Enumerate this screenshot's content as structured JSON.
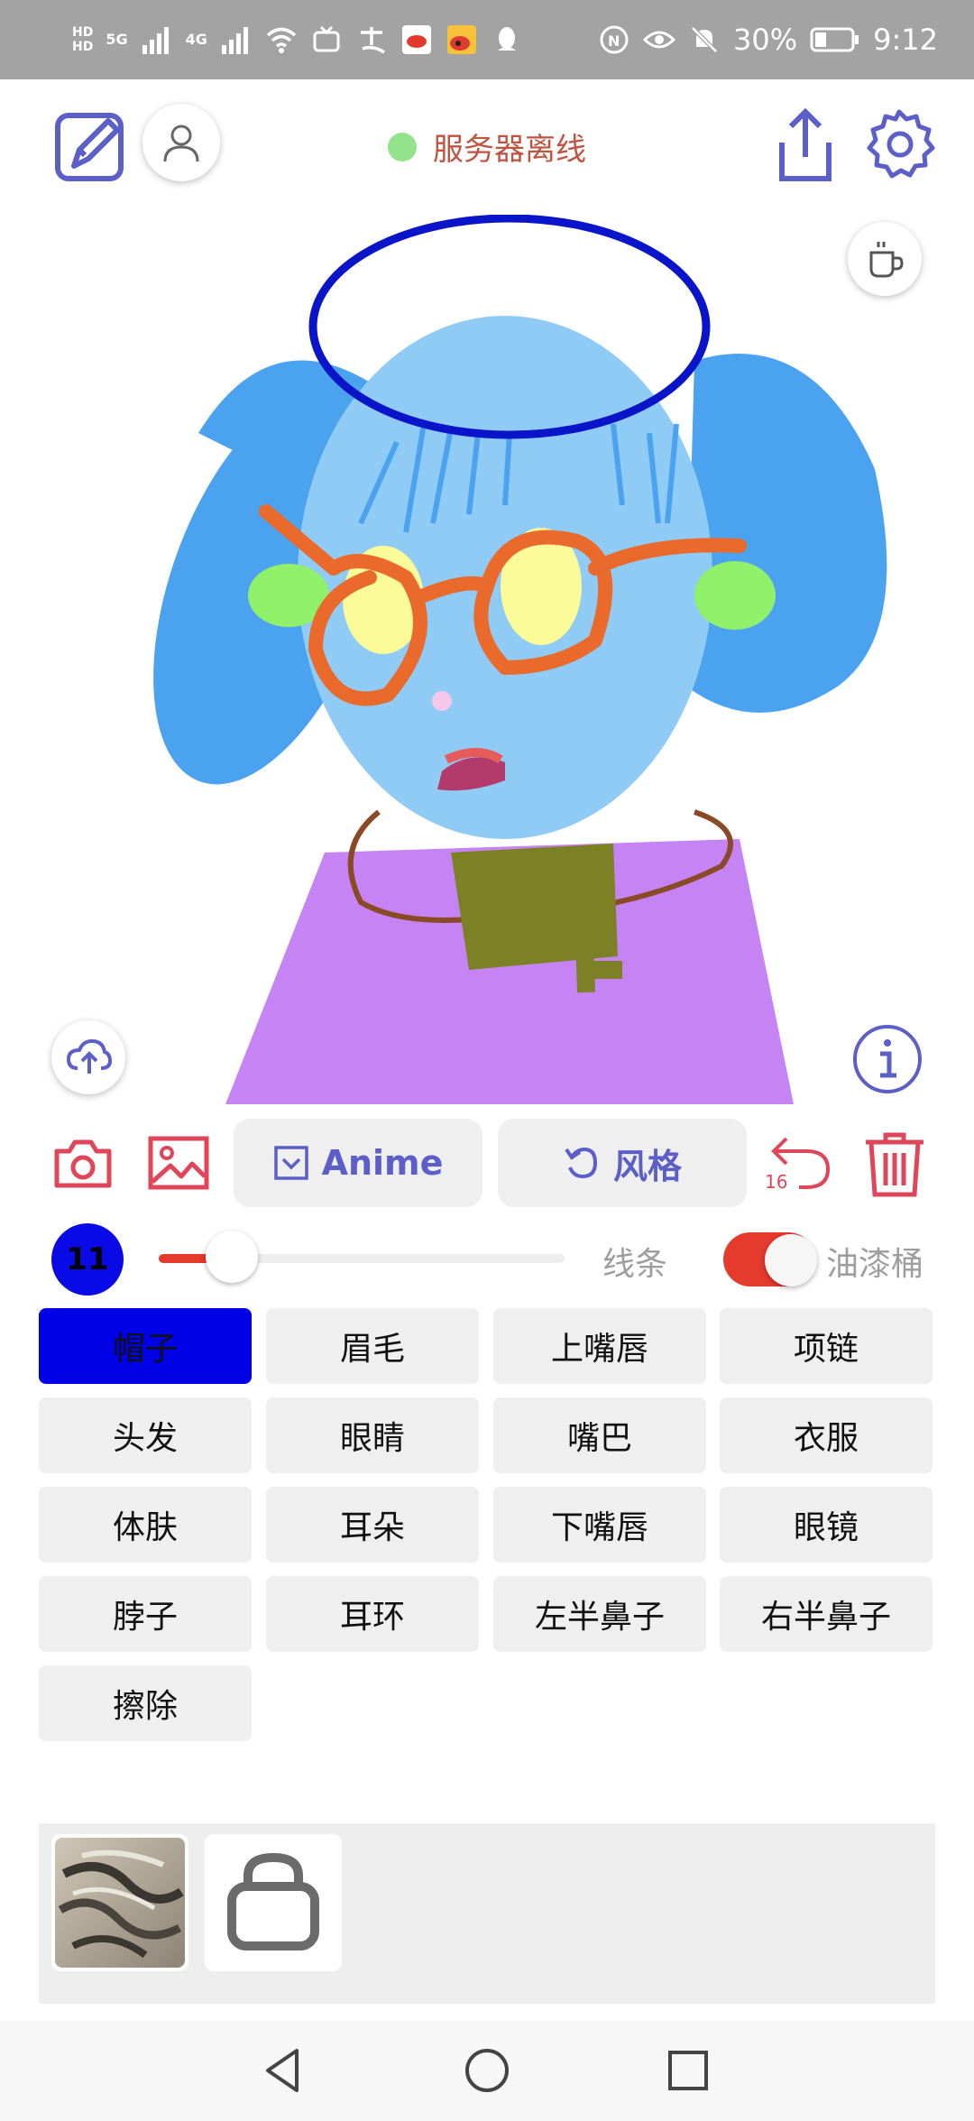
{
  "status_bar": {
    "network_chips": [
      "HD",
      "5G",
      "4G",
      "HD"
    ],
    "battery_percent": "30%",
    "time": "9:12"
  },
  "header": {
    "server_status_text": "服务器离线",
    "server_status_color": "#93e38b"
  },
  "toolbar": {
    "anime_label": "Anime",
    "style_label": "风格",
    "undo_count": "16"
  },
  "brush": {
    "size": "11",
    "slider_fraction": 0.17,
    "line_label": "线条",
    "fill_label": "油漆桶",
    "fill_enabled": true
  },
  "labels": [
    "帽子",
    "眉毛",
    "上嘴唇",
    "项链",
    "头发",
    "眼睛",
    "嘴巴",
    "衣服",
    "体肤",
    "耳朵",
    "下嘴唇",
    "眼镜",
    "脖子",
    "耳环",
    "左半鼻子",
    "右半鼻子",
    "擦除"
  ],
  "active_label": "帽子",
  "colors": {
    "accent": "#5b5fc7",
    "danger": "#e0465a",
    "active_label": "#0000e6",
    "toggle_on": "#e53a2e"
  },
  "icons": {
    "top_left": [
      "edit-icon",
      "user-icon"
    ],
    "top_right": [
      "share-icon",
      "settings-icon"
    ],
    "canvas": [
      "coffee-icon",
      "cloud-upload-icon",
      "info-icon"
    ],
    "toolbar": [
      "camera-icon",
      "image-icon",
      "undo-icon",
      "trash-icon"
    ],
    "nav": [
      "back-icon",
      "home-icon",
      "recents-icon"
    ]
  }
}
